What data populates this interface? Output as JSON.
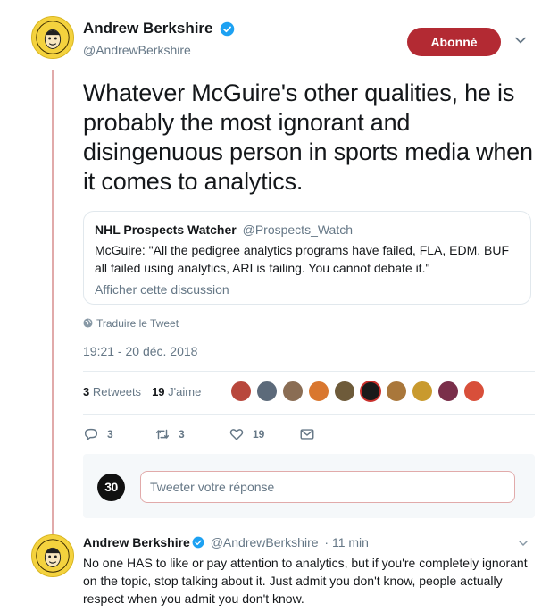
{
  "tweet": {
    "author_name": "Andrew Berkshire",
    "author_handle": "@AndrewBerkshire",
    "follow_label": "Abonné",
    "text": "Whatever McGuire's other qualities, he is probably the most ignorant and disingenuous person in sports media when it comes to analytics.",
    "quote": {
      "name": "NHL Prospects Watcher",
      "handle": "@Prospects_Watch",
      "text": "McGuire: \"All the pedigree analytics programs have failed, FLA, EDM, BUF all failed using analytics, ARI is failing. You cannot debate it.\"",
      "link": "Afficher cette discussion"
    },
    "translate_label": "Traduire le Tweet",
    "timestamp": "19:21 - 20 déc. 2018",
    "stats": {
      "retweets_count": "3",
      "retweets_label": "Retweets",
      "likes_count": "19",
      "likes_label": "J'aime"
    },
    "actions": {
      "replies": "3",
      "retweets": "3",
      "likes": "19"
    }
  },
  "reply_box": {
    "avatar_text": "30",
    "placeholder": "Tweeter votre réponse"
  },
  "reply_tweet": {
    "author_name": "Andrew Berkshire",
    "author_handle": "@AndrewBerkshire",
    "time": "· 11 min",
    "text": "No one HAS to like or pay attention to analytics, but if you're completely ignorant on the topic, stop talking about it. Just admit you don't know, people actually respect when you admit you don't know."
  },
  "colors": {
    "follow_button": "#b32a33",
    "thread_line": "#e1aaaa",
    "verified": "#1da1f2",
    "secondary_text": "#657786"
  }
}
